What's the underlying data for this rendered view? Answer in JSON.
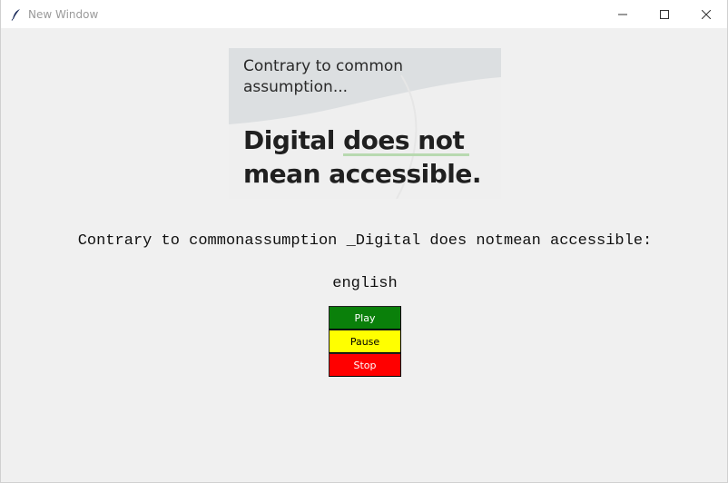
{
  "window": {
    "title": "New Window",
    "controls": {
      "minimize_icon": "minimize-icon",
      "maximize_icon": "maximize-icon",
      "close_icon": "close-icon"
    }
  },
  "banner": {
    "small_text_line1": "Contrary to common",
    "small_text_line2": "assumption...",
    "big_text_part1": "Digital ",
    "big_text_underlined": "does not",
    "big_text_line2": "mean accessible."
  },
  "caption": "Contrary to commonassumption _Digital does notmean accessible:",
  "language": "english",
  "buttons": {
    "play": "Play",
    "pause": "Pause",
    "stop": "Stop"
  },
  "colors": {
    "play": "#0a800a",
    "pause": "#ffff00",
    "stop": "#ff0000",
    "underline": "#b8d9b0"
  }
}
